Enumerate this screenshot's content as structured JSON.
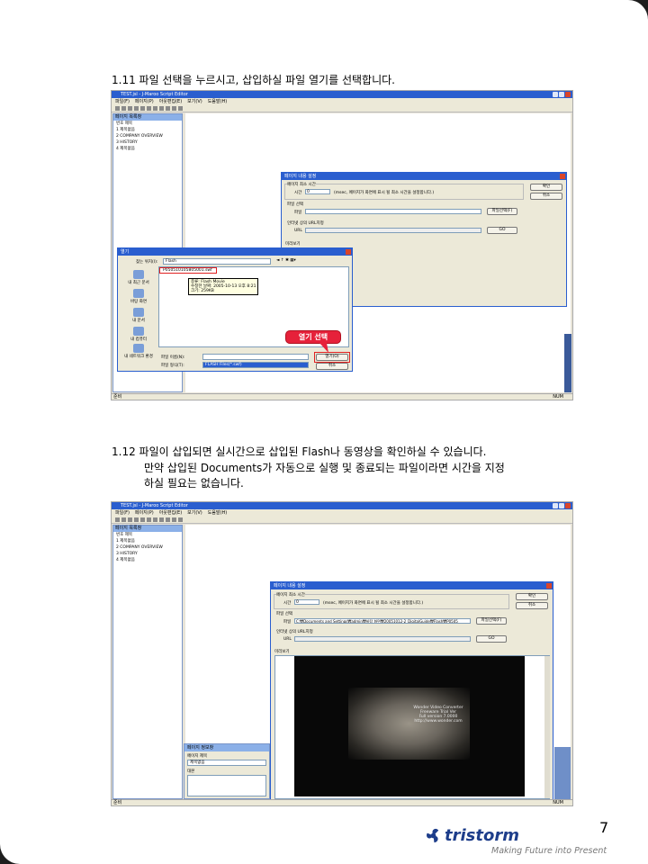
{
  "section1": {
    "caption": "1.11  파일 선택을 누르시고, 삽입하실 파일 열기를 선택합니다."
  },
  "section2": {
    "caption_line1": "1.12  파일이 삽입되면 실시간으로 삽입된 Flash나 동영상을 확인하실 수 있습니다.",
    "caption_line2": "만약 삽입된 Documents가 자동으로 실행 및 종료되는 파일이라면 시간을 지정",
    "caption_line3": "하실 필요는 없습니다."
  },
  "app": {
    "title": "TEST.jsl - J-Maroo Script Editor",
    "menu": [
      "파일(F)",
      "페이지(P)",
      "아웃편집(E)",
      "보기(V)",
      "도움말(H)"
    ],
    "panel_title": "페이지 목록창",
    "list_header": "번호   제목",
    "list_items": [
      "1   제목없음",
      "2   COMPANY OVERVIEW",
      "3   HISTORY",
      "4   제목없음"
    ],
    "status_left": "준비",
    "status_right": "NUM"
  },
  "settings_dialog": {
    "title": "페이지 내용 설정",
    "min_time_group": "페이지 최소 시간",
    "time_label": "시간",
    "time_value": "0",
    "time_hint": "(msec, 페이지가 화면에 표시 될 최소 시간을 설정합니다.)",
    "radio_file": "파일 선택",
    "file_label": "파일",
    "file_button": "파일선택(F)",
    "radio_url": "인터넷 상의 URL지정",
    "url_label": "URL",
    "go_button": "GO",
    "preview_label": "미리보기",
    "ok_button": "확인",
    "cancel_button": "취소",
    "file_path_value": "C:₩Documents and Settings₩admin₩바탕 화면₩20051012-2_DigitalGuide₩Flash₩P0505"
  },
  "open_dialog": {
    "title": "열기",
    "look_in_label": "찾는 위치(I):",
    "look_in_value": "Flash",
    "file_item": "P050510105805001.swf",
    "tooltip": [
      "종류: Flash Movie",
      "수정한 날짜: 2005-10-13 오후 8:21",
      "크기: 259KB"
    ],
    "places": [
      "내 최근 문서",
      "바탕 화면",
      "내 문서",
      "내 컴퓨터",
      "내 네트워크 환경"
    ],
    "filename_label": "파일 이름(N):",
    "filetype_label": "파일 형식(T):",
    "filetype_value": "FLASH Files(*.swf)",
    "open_button": "열기(O)",
    "cancel_button": "취소",
    "callout": "열기 선택"
  },
  "page_info_panel": {
    "title": "페이지 정보창",
    "page_title_label": "페이지 제목",
    "page_title_value": "제목없음",
    "body_label": "대본"
  },
  "video": {
    "overlay_lines": [
      "Wonder Video Converter",
      "Freeware Trial Ver",
      "Full version 7.0000",
      "http://www.wonder.com"
    ]
  },
  "footer": {
    "page_number": "7",
    "brand": "tristorm",
    "tagline": "Making Future into Present",
    "brand_color": "#1d3d8a",
    "icon": "tristorm-logo-icon"
  }
}
